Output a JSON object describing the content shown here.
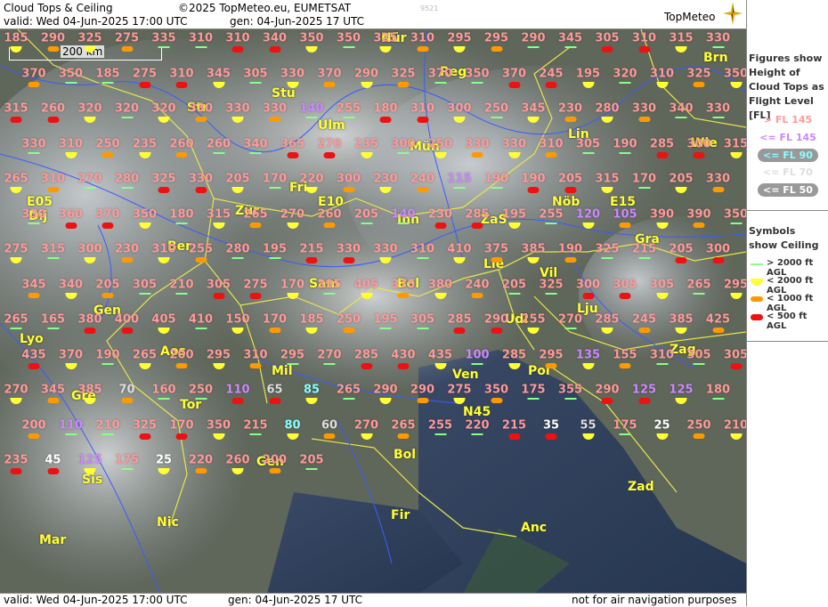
{
  "header": {
    "title": "Cloud Tops & Ceiling",
    "copyright": "©2025 TopMeteo.eu, EUMETSAT",
    "valid": "valid:  Wed  04-Jun-2025  17:00 UTC",
    "gen": "gen: 04-Jun-2025 17 UTC",
    "code": "9521",
    "logo": "TopMeteo"
  },
  "footer": {
    "valid": "valid:  Wed  04-Jun-2025  17:00 UTC",
    "gen": "gen: 04-Jun-2025 17 UTC",
    "note": "not for air navigation purposes"
  },
  "scale_label": "200 km",
  "legend": {
    "title": "Figures show Height of Cloud Tops as Flight Level  [FL]",
    "items": [
      {
        "label": "> FL 145",
        "color": "#ff9999"
      },
      {
        "label": "<= FL 145",
        "color": "#cc88ff"
      },
      {
        "label": "<= FL 90",
        "color": "#88ffff"
      },
      {
        "label": "<= FL 70",
        "color": "#dddddd"
      },
      {
        "label": "<= FL 50",
        "color": "#ffffff"
      }
    ],
    "ceiling_title": "Symbols show Ceiling",
    "ceiling": [
      {
        "label": "> 2000 ft AGL",
        "color": "#88ff88"
      },
      {
        "label": "< 2000 ft AGL",
        "color": "#ffff33"
      },
      {
        "label": "< 1000 ft AGL",
        "color": "#ff9900"
      },
      {
        "label": "< 500 ft AGL",
        "color": "#ee1111"
      }
    ]
  },
  "cities": [
    "Nür",
    "Reg",
    "Brn",
    "Stu",
    "Str",
    "Ulm",
    "Mün",
    "Lin",
    "Wie",
    "Fri",
    "Zür",
    "Inn",
    "ZaS",
    "Dij",
    "Ber",
    "Gra",
    "Lie",
    "Vil",
    "Sam",
    "Bol",
    "Lju",
    "Gen",
    "Udi",
    "Lyo",
    "Aos",
    "Zag",
    "Mil",
    "Ven",
    "Pol",
    "Gre",
    "Tor",
    "N45",
    "E05",
    "E10",
    "E15",
    "Sis",
    "Nic",
    "Gen",
    "Bol",
    "Zad",
    "Fir",
    "Mar",
    "Anc",
    "Nöb"
  ],
  "values": [
    "185",
    "290",
    "325",
    "275",
    "335",
    "310",
    "310",
    "340",
    "350",
    "350",
    "325",
    "310",
    "295",
    "295",
    "290",
    "345",
    "305",
    "310",
    "315",
    "330",
    "370",
    "350",
    "185",
    "275",
    "310",
    "345",
    "305",
    "330",
    "370",
    "290",
    "325",
    "370",
    "350",
    "370",
    "245",
    "195",
    "320",
    "310",
    "325",
    "350",
    "315",
    "260",
    "320",
    "320",
    "320",
    "330",
    "330",
    "330",
    "140",
    "255",
    "180",
    "310",
    "300",
    "250",
    "345",
    "230",
    "280",
    "330",
    "340",
    "330",
    "330",
    "310",
    "250",
    "235",
    "260",
    "260",
    "340",
    "365",
    "270",
    "235",
    "300",
    "250",
    "330",
    "330",
    "310",
    "305",
    "190",
    "285",
    "300",
    "315",
    "265",
    "310",
    "270",
    "280",
    "325",
    "330",
    "205",
    "170",
    "220",
    "300",
    "230",
    "240",
    "115",
    "190",
    "190",
    "205",
    "315",
    "170",
    "205",
    "330",
    "330",
    "360",
    "370",
    "350",
    "180",
    "315",
    "265",
    "270",
    "260",
    "205",
    "140",
    "230",
    "285",
    "195",
    "255",
    "120",
    "105",
    "390",
    "390",
    "350",
    "275",
    "315",
    "300",
    "230",
    "310",
    "255",
    "280",
    "195",
    "215",
    "330",
    "330",
    "310",
    "410",
    "375",
    "385",
    "190",
    "325",
    "215",
    "205",
    "300",
    "345",
    "340",
    "205",
    "305",
    "210",
    "305",
    "275",
    "170",
    "395",
    "405",
    "375",
    "380",
    "240",
    "205",
    "325",
    "300",
    "305",
    "305",
    "265",
    "295",
    "265",
    "165",
    "380",
    "400",
    "405",
    "410",
    "150",
    "170",
    "185",
    "250",
    "195",
    "305",
    "285",
    "290",
    "255",
    "270",
    "285",
    "245",
    "385",
    "425",
    "435",
    "370",
    "190",
    "265",
    "200",
    "295",
    "310",
    "295",
    "270",
    "285",
    "430",
    "435",
    "100",
    "285",
    "295",
    "135",
    "155",
    "310",
    "305",
    "305",
    "270",
    "345",
    "385",
    "70",
    "160",
    "250",
    "110",
    "65",
    "85",
    "265",
    "290",
    "290",
    "275",
    "350",
    "175",
    "355",
    "290",
    "125",
    "125",
    "180",
    "200",
    "110",
    "210",
    "325",
    "170",
    "350",
    "215",
    "80",
    "60",
    "270",
    "265",
    "255",
    "220",
    "215",
    "35",
    "55",
    "175",
    "25",
    "250",
    "210",
    "235",
    "45",
    "125",
    "175",
    "25",
    "220",
    "260",
    "200",
    "205"
  ]
}
